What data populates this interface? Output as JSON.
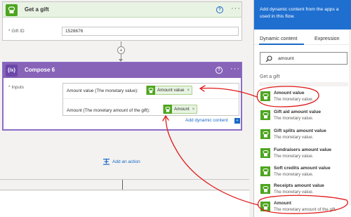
{
  "gift_card": {
    "title": "Get a gift",
    "help": "?",
    "more": "···",
    "field_label": "* Gift ID",
    "field_value": "1528676"
  },
  "connector": {
    "plus": "+"
  },
  "compose_card": {
    "title": "Compose 6",
    "icon_text": "{/x}",
    "help": "?",
    "more": "···",
    "inputs_label": "* Inputs",
    "line1_text": "Amount value (The monetary value):",
    "line1_token": "Amount value",
    "line2_text": "Amount (The monetary amount of the gift):",
    "line2_token": "Amount",
    "token_remove": "×",
    "add_dynamic": "Add dynamic content",
    "add_dynamic_icon": "+"
  },
  "add_action": {
    "label": "Add an action"
  },
  "pane": {
    "header_line1": "Add dynamic content from the apps a",
    "header_line2": "used in this flow.",
    "tabs": [
      {
        "label": "Dynamic content",
        "active": true
      },
      {
        "label": "Expression",
        "active": false
      }
    ],
    "search_value": "amount",
    "section_title": "Get a gift",
    "items": [
      {
        "title": "Amount value",
        "desc": "The monetary value."
      },
      {
        "title": "Gift aid amount value",
        "desc": "The monetary value."
      },
      {
        "title": "Gift splits amount value",
        "desc": "The monetary value."
      },
      {
        "title": "Fundraisers amount value",
        "desc": "The monetary value."
      },
      {
        "title": "Soft credits amount value",
        "desc": "The monetary value."
      },
      {
        "title": "Receipts amount value",
        "desc": "The monetary value."
      },
      {
        "title": "Amount",
        "desc": "The monetary amount of the gift."
      }
    ]
  },
  "colors": {
    "accent_blue": "#1f6fd0",
    "compose_purple": "#8764b8",
    "gift_green": "#4da51f",
    "annotation_red": "#e01b1b"
  },
  "icons": {
    "gift": "gift-icon",
    "compose": "compose-icon",
    "search": "search-icon",
    "add_action": "add-action-icon",
    "help": "help-icon",
    "more": "more-options-icon"
  }
}
